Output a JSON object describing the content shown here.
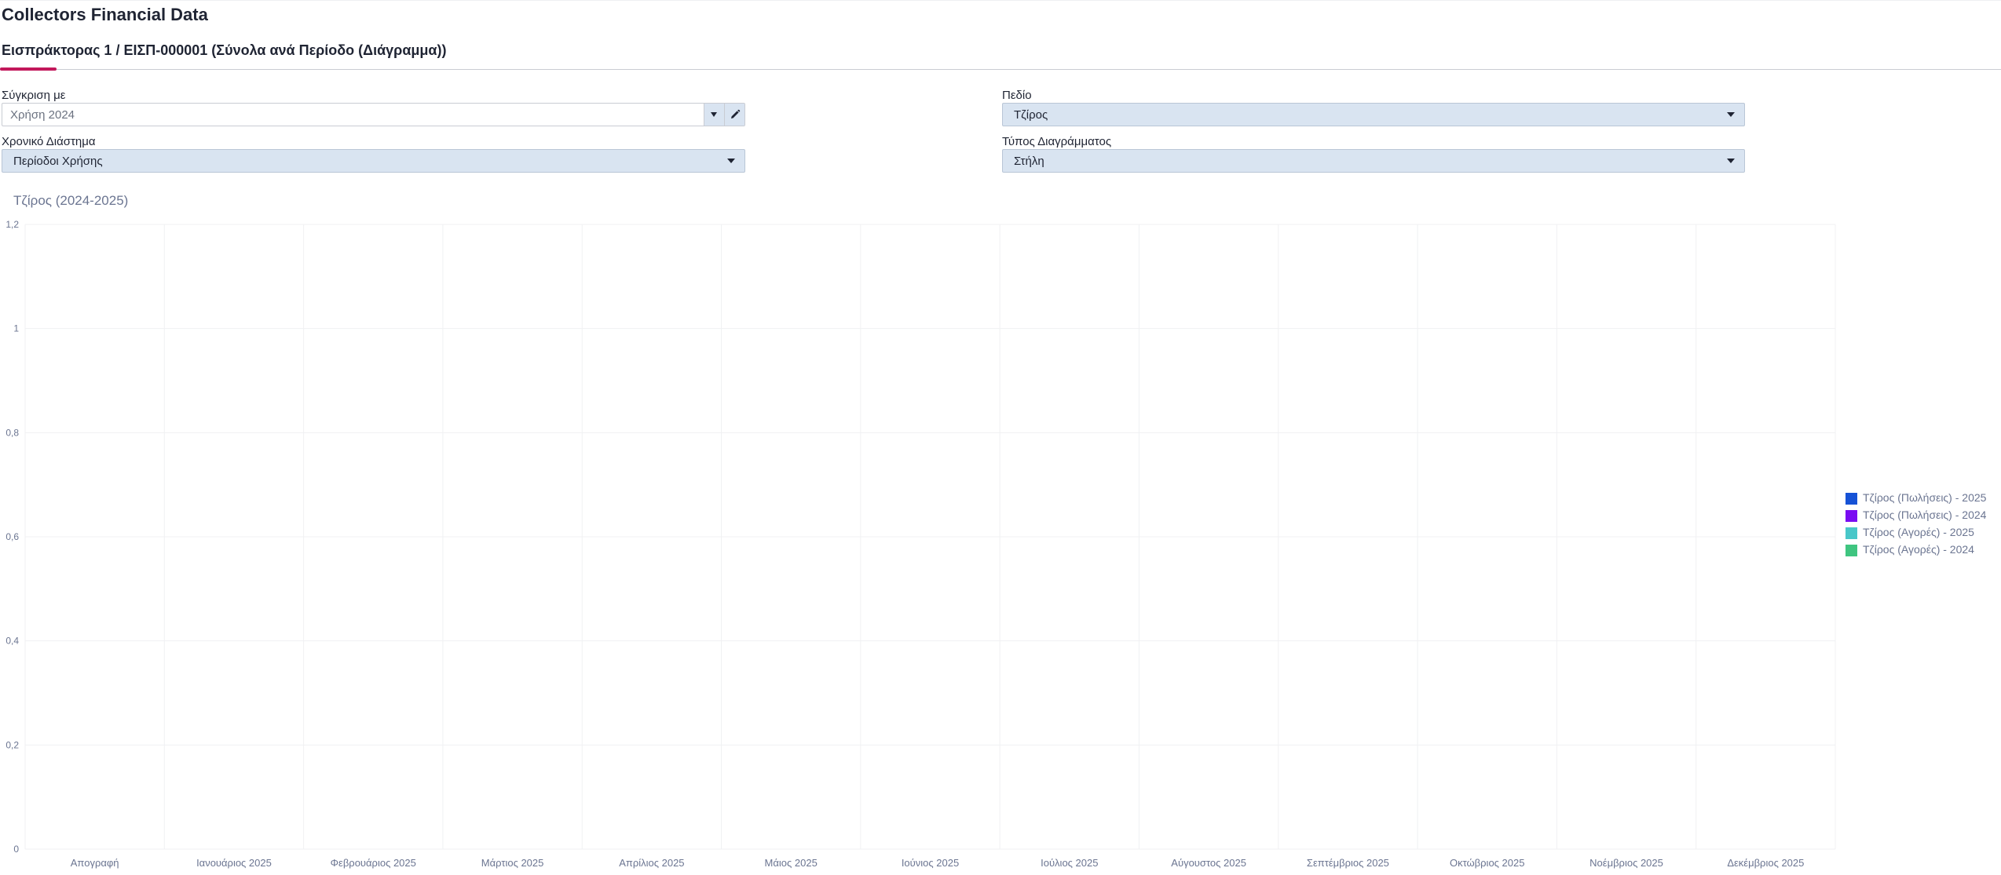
{
  "app": {
    "title": "Collectors Financial Data"
  },
  "tab": {
    "label": "Εισπράκτορας 1 / ΕΙΣΠ-000001 (Σύνολα ανά Περίοδο (Διάγραμμα))"
  },
  "filters": {
    "compare": {
      "label": "Σύγκριση με",
      "placeholder": "Χρήση 2024"
    },
    "field": {
      "label": "Πεδίο",
      "value": "Τζίρος"
    },
    "period": {
      "label": "Χρονικό Διάστημα",
      "value": "Περίοδοι Χρήσης"
    },
    "chart_type": {
      "label": "Τύπος Διαγράμματος",
      "value": "Στήλη"
    }
  },
  "icons": {
    "dropdown": "chevron-down-icon",
    "edit": "pencil-icon"
  },
  "chart_data": {
    "type": "bar",
    "title": "Τζίρος (2024-2025)",
    "xlabel": "",
    "ylabel": "",
    "ylim": [
      0,
      1.2
    ],
    "yticks": [
      "0",
      "0,2",
      "0,4",
      "0,6",
      "0,8",
      "1",
      "1,2"
    ],
    "categories": [
      "Απογραφή",
      "Ιανουάριος 2025",
      "Φεβρουάριος 2025",
      "Μάρτιος 2025",
      "Απρίλιος 2025",
      "Μάιος 2025",
      "Ιούνιος 2025",
      "Ιούλιος 2025",
      "Αύγουστος 2025",
      "Σεπτέμβριος 2025",
      "Οκτώβριος 2025",
      "Νοέμβριος 2025",
      "Δεκέμβριος 2025"
    ],
    "series": [
      {
        "name": "Τζίρος (Πωλήσεις) - 2025",
        "color": "#1652d6",
        "values": [
          0,
          0,
          0,
          0,
          0,
          0,
          0,
          0,
          0,
          0,
          0,
          0,
          0
        ]
      },
      {
        "name": "Τζίρος (Πωλήσεις) - 2024",
        "color": "#7a0cf2",
        "values": [
          0,
          0,
          0,
          0,
          0,
          0,
          0,
          0,
          0,
          0,
          0,
          0,
          0
        ]
      },
      {
        "name": "Τζίρος (Αγορές) - 2025",
        "color": "#48c7c9",
        "values": [
          0,
          0,
          0,
          0,
          0,
          0,
          0,
          0,
          0,
          0,
          0,
          0,
          0
        ]
      },
      {
        "name": "Τζίρος (Αγορές) - 2024",
        "color": "#3fc580",
        "values": [
          0,
          0,
          0,
          0,
          0,
          0,
          0,
          0,
          0,
          0,
          0,
          0,
          0
        ]
      }
    ],
    "grid": true,
    "legend": "right"
  }
}
